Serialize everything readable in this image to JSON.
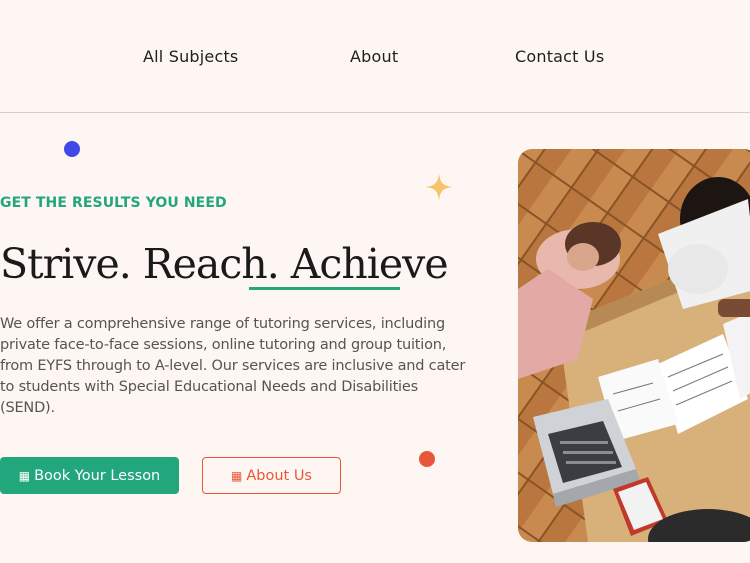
{
  "nav": {
    "items": [
      {
        "label": "All Subjects"
      },
      {
        "label": "About"
      },
      {
        "label": "Contact Us"
      }
    ]
  },
  "hero": {
    "eyebrow": "GET THE RESULTS YOU NEED",
    "headline_plain": "Strive. Reach.",
    "headline_accent": "Achieve",
    "description": "We offer a comprehensive range of tutoring services, including private face-to-face sessions, online tutoring and group tuition, from EYFS through to A-level. Our services are inclusive and cater to students with Special Educational Needs and Disabilities (SEND).",
    "primary_button": {
      "icon": "calendar-icon",
      "label": "Book Your Lesson"
    },
    "secondary_button": {
      "icon": "info-icon",
      "label": "About Us"
    },
    "image": {
      "subject": "students studying around a table with laptop, notebooks and phone"
    }
  },
  "colors": {
    "background": "#fdf6f2",
    "accent_green": "#22a77c",
    "accent_orange": "#e9573a",
    "accent_blue": "#3f48e6",
    "sparkle_yellow": "#f7c26b"
  }
}
